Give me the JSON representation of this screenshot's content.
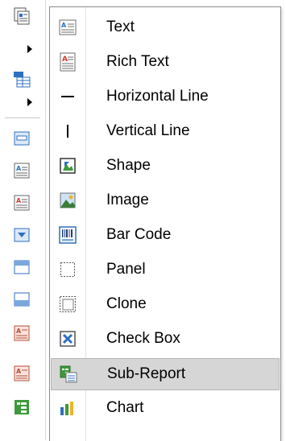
{
  "menu": {
    "items": [
      {
        "label": "Text",
        "icon": "text-icon"
      },
      {
        "label": "Rich Text",
        "icon": "rich-text-icon"
      },
      {
        "label": "Horizontal Line",
        "icon": "horizontal-line-icon"
      },
      {
        "label": "Vertical Line",
        "icon": "vertical-line-icon"
      },
      {
        "label": "Shape",
        "icon": "shape-icon"
      },
      {
        "label": "Image",
        "icon": "image-icon"
      },
      {
        "label": "Bar Code",
        "icon": "bar-code-icon"
      },
      {
        "label": "Panel",
        "icon": "panel-icon"
      },
      {
        "label": "Clone",
        "icon": "clone-icon"
      },
      {
        "label": "Check Box",
        "icon": "check-box-icon"
      },
      {
        "label": "Sub-Report",
        "icon": "sub-report-icon",
        "highlighted": true
      },
      {
        "label": "Chart",
        "icon": "chart-icon"
      }
    ]
  },
  "colors": {
    "highlight": "#d6d6d6",
    "highlight_border": "#b5b5b5",
    "menu_border": "#8c8c8c",
    "accent_red": "#d23a2a",
    "accent_blue": "#2f6fbf",
    "accent_green": "#3c9a3c"
  }
}
